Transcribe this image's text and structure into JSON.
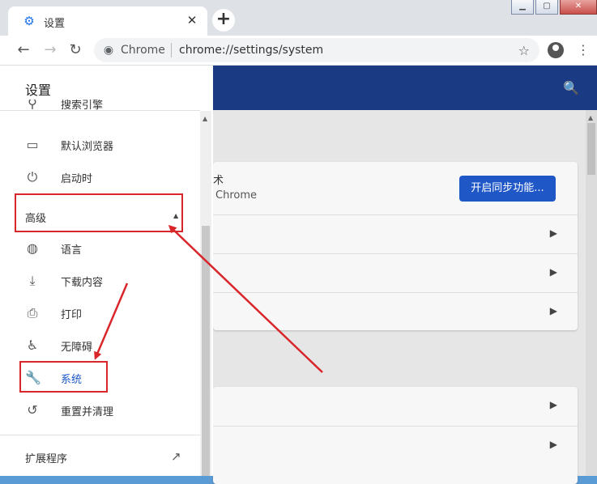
{
  "tab": {
    "title": "设置",
    "favicon": "gear-icon"
  },
  "omnibox": {
    "site_name": "Chrome",
    "url": "chrome://settings/system"
  },
  "drawer": {
    "title": "设置",
    "items_top": [
      {
        "label": "搜索引擎",
        "icon": "search-icon"
      },
      {
        "label": "默认浏览器",
        "icon": "browser-window-icon"
      },
      {
        "label": "启动时",
        "icon": "power-icon"
      }
    ],
    "advanced_label": "高级",
    "items_advanced": [
      {
        "label": "语言",
        "icon": "globe-icon"
      },
      {
        "label": "下载内容",
        "icon": "download-icon"
      },
      {
        "label": "打印",
        "icon": "printer-icon"
      },
      {
        "label": "无障碍",
        "icon": "accessibility-icon"
      },
      {
        "label": "系统",
        "icon": "wrench-icon"
      },
      {
        "label": "重置并清理",
        "icon": "restore-icon"
      }
    ],
    "extensions_label": "扩展程序"
  },
  "main": {
    "sync_text_1": "术",
    "sync_text_2": "Chrome",
    "sync_button": "开启同步功能..."
  },
  "colors": {
    "header": "#1a3a84",
    "accent": "#1a56c9",
    "annotation": "#d9262b"
  }
}
